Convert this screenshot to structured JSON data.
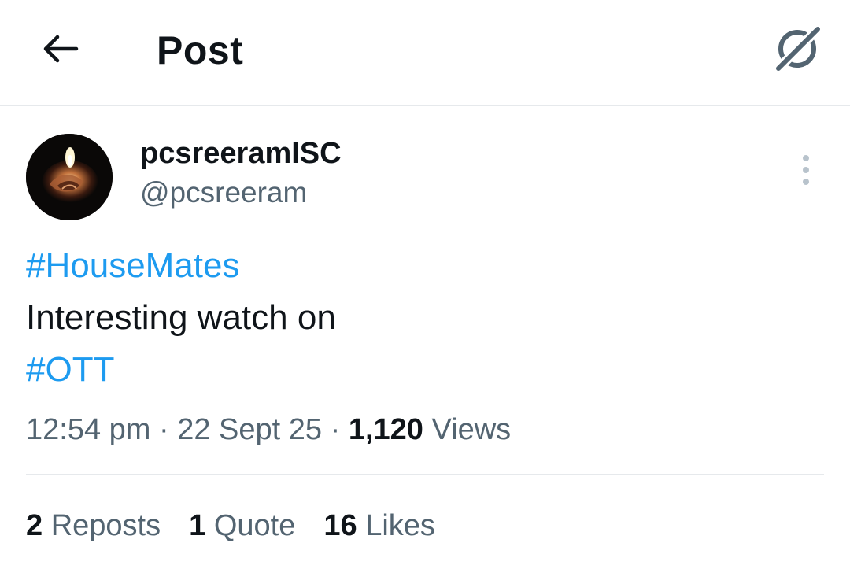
{
  "header": {
    "title": "Post",
    "back_icon": "arrow-left-icon",
    "grok_icon": "grok-icon"
  },
  "author": {
    "display_name": "pcsreeramISC",
    "handle": "@pcsreeram",
    "avatar": "candle-rose-avatar",
    "more_icon": "more-vertical-icon"
  },
  "post": {
    "hashtag_1": "#HouseMates",
    "text": "Interesting watch on",
    "hashtag_2": "#OTT"
  },
  "meta": {
    "time": "12:54 pm",
    "separator": " · ",
    "date": "22 Sept 25",
    "views_count": "1,120",
    "views_label": "Views"
  },
  "stats": {
    "reposts_count": "2",
    "reposts_label": "Reposts",
    "quotes_count": "1",
    "quotes_label": "Quote",
    "likes_count": "16",
    "likes_label": "Likes"
  },
  "colors": {
    "link": "#1d9bf0",
    "text": "#0f1419",
    "secondary": "#536471",
    "divider": "#e6e9ec"
  }
}
